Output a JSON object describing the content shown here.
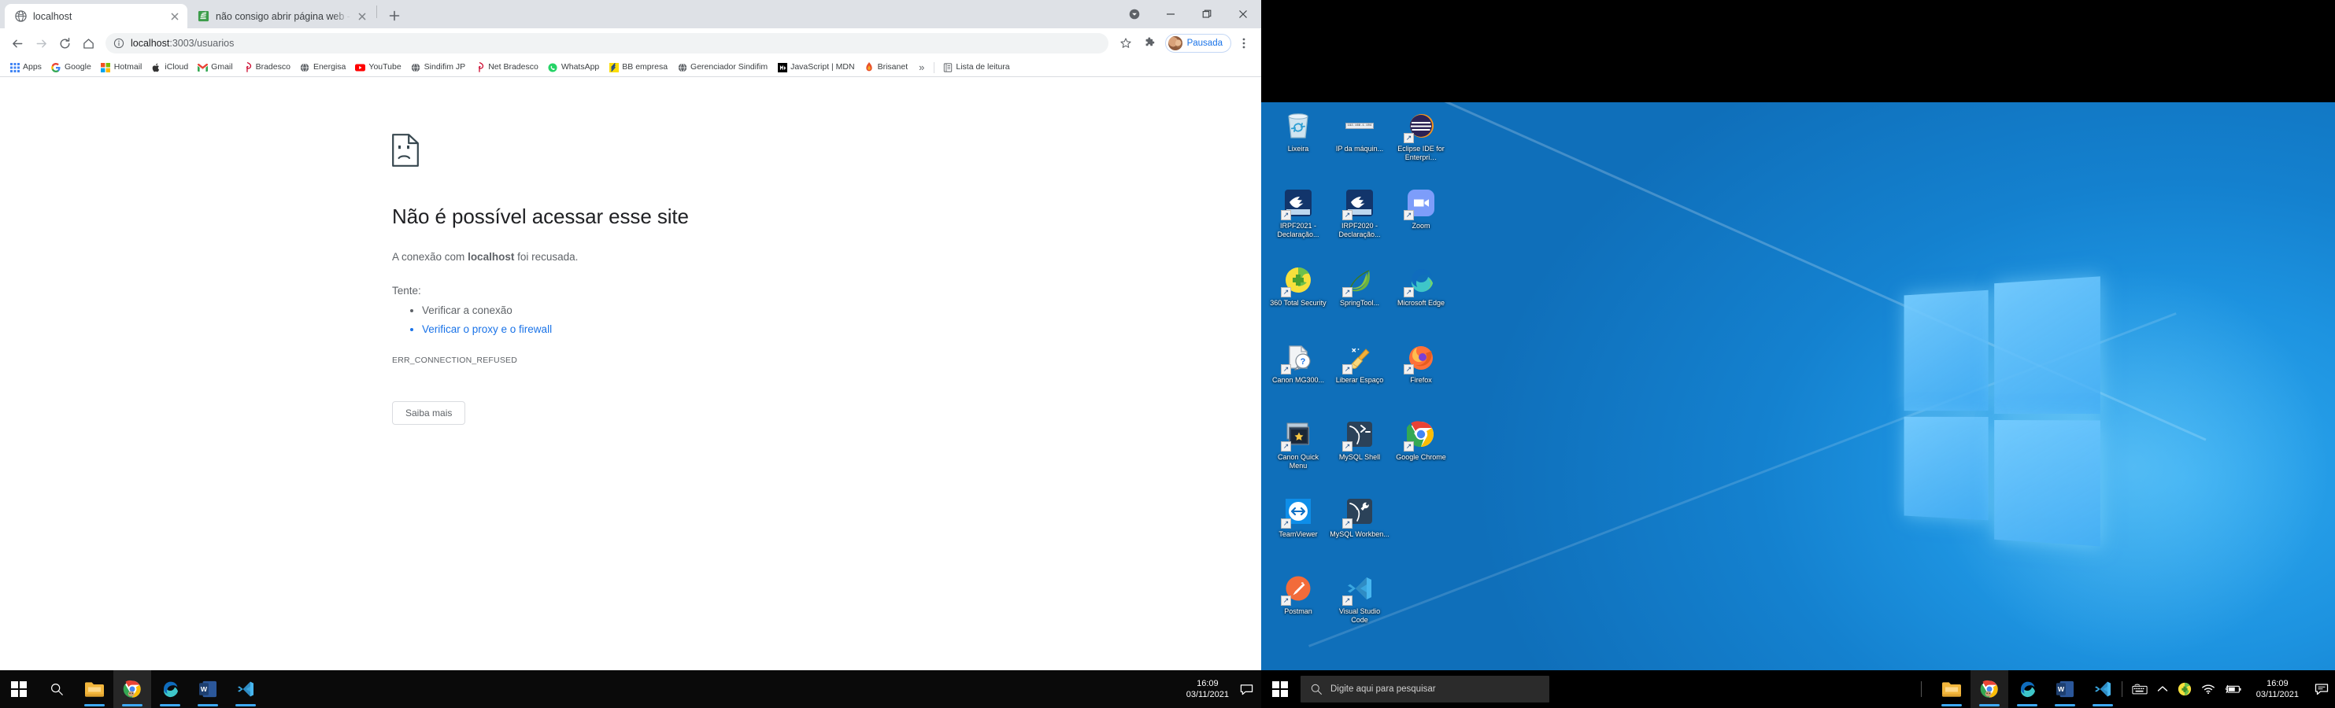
{
  "browser": {
    "tabs": [
      {
        "title": "localhost",
        "favicon": "globe-icon",
        "active": true
      },
      {
        "title": "não consigo abrir página web - S",
        "favicon": "stackoverflow-green-icon",
        "active": false
      }
    ],
    "new_tab_label": "+",
    "window_controls": {
      "minimize": "—",
      "maximize": "❐",
      "close": "✕",
      "caret": "▾"
    },
    "toolbar": {
      "back": "←",
      "forward": "→",
      "reload": "⟳",
      "home": "⌂",
      "url": "localhost:3003/usuarios",
      "url_host": "localhost",
      "url_path": ":3003/usuarios",
      "site_info": "info-circle-icon",
      "bookmark_star": "☆",
      "extensions": "puzzle-icon",
      "profile_label": "Pausada",
      "menu": "⋮"
    },
    "bookmarks": [
      {
        "label": "Apps",
        "icon": "apps-grid-icon",
        "color": "#4285f4"
      },
      {
        "label": "Google",
        "icon": "google-g-icon",
        "color": "#ea4335"
      },
      {
        "label": "Hotmail",
        "icon": "microsoft-icon",
        "color": "#f25022"
      },
      {
        "label": "iCloud",
        "icon": "apple-icon",
        "color": "#333333"
      },
      {
        "label": "Gmail",
        "icon": "gmail-m-icon",
        "color": "#ea4335"
      },
      {
        "label": "Bradesco",
        "icon": "bradesco-icon",
        "color": "#cc092f"
      },
      {
        "label": "Energisa",
        "icon": "globe-icon",
        "color": "#5f6368"
      },
      {
        "label": "YouTube",
        "icon": "youtube-icon",
        "color": "#ff0000"
      },
      {
        "label": "Sindifim JP",
        "icon": "globe-icon",
        "color": "#5f6368"
      },
      {
        "label": "Net Bradesco",
        "icon": "bradesco-icon",
        "color": "#cc092f"
      },
      {
        "label": "WhatsApp",
        "icon": "whatsapp-icon",
        "color": "#25d366"
      },
      {
        "label": "BB empresa",
        "icon": "banco-brasil-icon",
        "color": "#fcdd06"
      },
      {
        "label": "Gerenciador Sindifim",
        "icon": "globe-icon",
        "color": "#5f6368"
      },
      {
        "label": "JavaScript | MDN",
        "icon": "mdn-icon",
        "color": "#000000"
      },
      {
        "label": "Brisanet",
        "icon": "brisanet-icon",
        "color": "#e8502a"
      }
    ],
    "bookmarks_overflow": "»",
    "reading_list_label": "Lista de leitura",
    "reading_list_icon": "reading-list-icon"
  },
  "error_page": {
    "icon": "sad-file-icon",
    "title": "Não é possível acessar esse site",
    "subtitle_before": "A conexão com ",
    "subtitle_host": "localhost",
    "subtitle_after": " foi recusada.",
    "try_label": "Tente:",
    "suggestions": [
      {
        "text": "Verificar a conexão",
        "is_link": false
      },
      {
        "text": "Verificar o proxy e o firewall",
        "is_link": true
      }
    ],
    "error_code": "ERR_CONNECTION_REFUSED",
    "button_label": "Saiba mais"
  },
  "desktop": {
    "icons": [
      {
        "label": "Lixeira",
        "icon": "recycle-bin-icon",
        "shortcut": false
      },
      {
        "label": "IP da máquin...",
        "icon": "ip-text-icon",
        "shortcut": false,
        "badge_text": "192.168.1.104"
      },
      {
        "label": "Eclipse IDE for Enterpri…",
        "icon": "eclipse-icon",
        "shortcut": true
      },
      {
        "label": "IRPF2021 - Declaração...",
        "icon": "receita-federal-icon",
        "shortcut": true
      },
      {
        "label": "IRPF2020 - Declaração...",
        "icon": "receita-federal-icon",
        "shortcut": true
      },
      {
        "label": "Zoom",
        "icon": "zoom-icon",
        "shortcut": true
      },
      {
        "label": "360 Total Security",
        "icon": "360-security-icon",
        "shortcut": true
      },
      {
        "label": "SpringTool...",
        "icon": "spring-tools-icon",
        "shortcut": true
      },
      {
        "label": "Microsoft Edge",
        "icon": "edge-icon",
        "shortcut": true
      },
      {
        "label": "Canon MG300...",
        "icon": "canon-help-icon",
        "shortcut": true
      },
      {
        "label": "Liberar Espaço",
        "icon": "broom-cleanup-icon",
        "shortcut": true
      },
      {
        "label": "Firefox",
        "icon": "firefox-icon",
        "shortcut": true
      },
      {
        "label": "Canon Quick Menu",
        "icon": "canon-quick-menu-icon",
        "shortcut": true
      },
      {
        "label": "MySQL Shell",
        "icon": "mysql-shell-icon",
        "shortcut": true
      },
      {
        "label": "Google Chrome",
        "icon": "chrome-icon",
        "shortcut": true
      },
      {
        "label": "TeamViewer",
        "icon": "teamviewer-icon",
        "shortcut": true
      },
      {
        "label": "MySQL Workben...",
        "icon": "mysql-workbench-icon",
        "shortcut": true
      },
      {
        "label": "",
        "icon": "empty-icon",
        "shortcut": false
      },
      {
        "label": "Postman",
        "icon": "postman-icon",
        "shortcut": true
      },
      {
        "label": "Visual Studio Code",
        "icon": "vscode-icon",
        "shortcut": true
      }
    ]
  },
  "taskbar_left": {
    "start_icon": "windows-start-icon",
    "search_icon": "search-icon",
    "apps": [
      {
        "name": "file-explorer-icon",
        "running": true,
        "active": false
      },
      {
        "name": "chrome-icon",
        "running": true,
        "active": true
      },
      {
        "name": "edge-icon",
        "running": true,
        "active": false
      },
      {
        "name": "word-icon",
        "running": true,
        "active": false
      },
      {
        "name": "vscode-icon",
        "running": true,
        "active": false
      }
    ],
    "clock_time": "16:09",
    "clock_date": "03/11/2021",
    "notification_icon": "notification-icon"
  },
  "taskbar_right": {
    "start_icon": "windows-start-icon",
    "search_icon": "search-icon",
    "search_placeholder": "Digite aqui para pesquisar",
    "apps": [
      {
        "name": "file-explorer-icon",
        "running": true,
        "active": false
      },
      {
        "name": "chrome-icon",
        "running": true,
        "active": true
      },
      {
        "name": "edge-icon",
        "running": true,
        "active": false
      },
      {
        "name": "word-icon",
        "running": true,
        "active": false
      },
      {
        "name": "vscode-icon",
        "running": true,
        "active": false
      }
    ],
    "tray": [
      {
        "name": "keyboard-layout-icon",
        "glyph": "⌨"
      },
      {
        "name": "show-hidden-icons-chevron-icon",
        "glyph": "⌃"
      },
      {
        "name": "360-security-tray-icon",
        "glyph": "✚"
      },
      {
        "name": "wifi-icon",
        "glyph": "wifi"
      },
      {
        "name": "battery-charging-icon",
        "glyph": "battery"
      }
    ],
    "clock_time": "16:09",
    "clock_date": "03/11/2021",
    "notification_icon": "notification-icon"
  },
  "colors": {
    "chrome_tabstrip": "#dee1e6",
    "chrome_omnibox": "#f1f3f4",
    "link_blue": "#1a73e8",
    "taskbar_black": "#000000",
    "desktop_blue": "#1d93e0"
  }
}
